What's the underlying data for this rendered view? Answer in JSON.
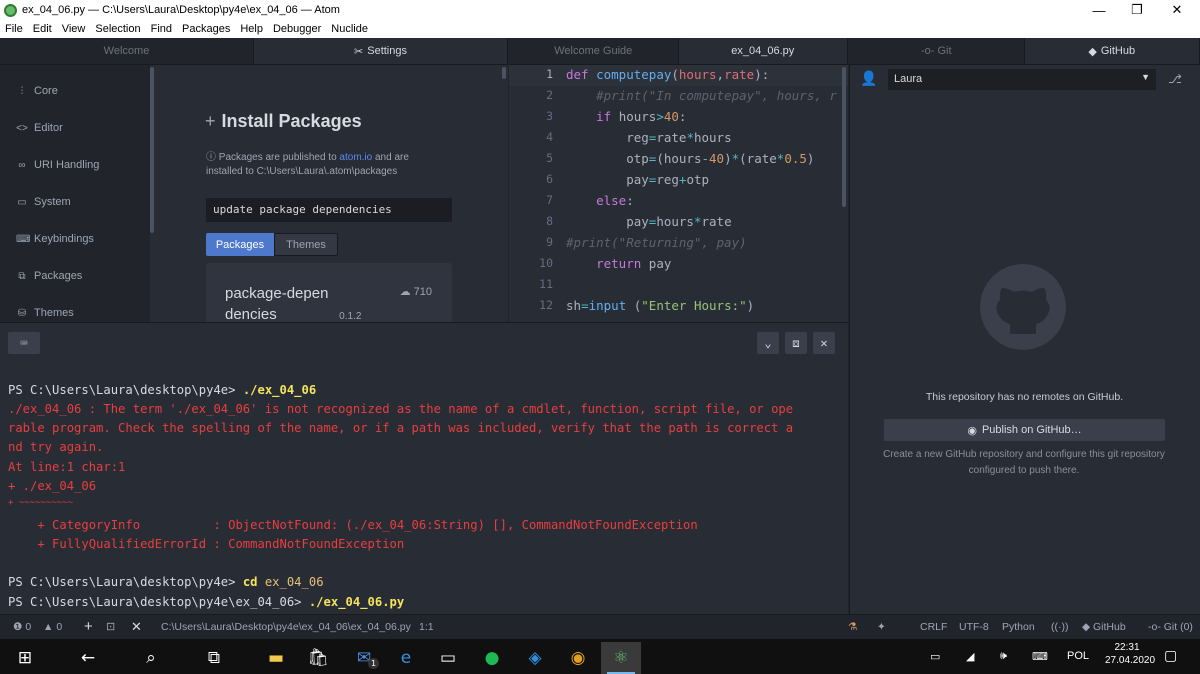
{
  "window": {
    "title": "ex_04_06.py — C:\\Users\\Laura\\Desktop\\py4e\\ex_04_06 — Atom"
  },
  "menu": [
    "File",
    "Edit",
    "View",
    "Selection",
    "Find",
    "Packages",
    "Help",
    "Debugger",
    "Nuclide"
  ],
  "tabs_left": [
    {
      "label": "Welcome"
    },
    {
      "label": "Settings",
      "icon": "tools-icon"
    }
  ],
  "tabs_mid": [
    {
      "label": "Welcome Guide"
    },
    {
      "label": "ex_04_06.py"
    }
  ],
  "tabs_right": [
    {
      "label": "Git",
      "icon": "git-commit-icon"
    },
    {
      "label": "GitHub",
      "icon": "github-icon"
    }
  ],
  "settings": {
    "nav": [
      "Core",
      "Editor",
      "URI Handling",
      "System",
      "Keybindings",
      "Packages",
      "Themes"
    ],
    "install_title": "Install Packages",
    "note_pre": "Packages are published to",
    "note_link": "atom.io",
    "note_post": "and are installed to C:\\Users\\Laura\\.atom\\packages",
    "search_value": "update package dependencies",
    "seg_packages": "Packages",
    "seg_themes": "Themes",
    "package": {
      "name": "package-dependencies",
      "version": "0.1.2",
      "downloads": "710"
    }
  },
  "editor": {
    "line_numbers": [
      "1",
      "2",
      "3",
      "4",
      "5",
      "6",
      "7",
      "8",
      "9",
      "10",
      "11",
      "12"
    ],
    "current_line": 1
  },
  "github": {
    "user": "Laura",
    "no_remotes": "This repository has no remotes on GitHub.",
    "publish_label": "Publish on GitHub…",
    "sub1": "Create a new GitHub repository and configure this git repository",
    "sub2": "configured to push there."
  },
  "terminal": {
    "prompt1": "PS C:\\Users\\Laura\\desktop\\py4e> ",
    "cmd1": "./ex_04_06",
    "err": [
      "./ex_04_06 : The term './ex_04_06' is not recognized as the name of a cmdlet, function, script file, or ope",
      "rable program. Check the spelling of the name, or if a path was included, verify that the path is correct a",
      "nd try again.",
      "At line:1 char:1",
      "+ ./ex_04_06",
      "+ ~~~~~~~~~~",
      "    + CategoryInfo          : ObjectNotFound: (./ex_04_06:String) [], CommandNotFoundException",
      "    + FullyQualifiedErrorId : CommandNotFoundException"
    ],
    "prompt2": "PS C:\\Users\\Laura\\desktop\\py4e> ",
    "cmd2a": "cd",
    "cmd2b": " ex_04_06",
    "prompt3": "PS C:\\Users\\Laura\\desktop\\py4e\\ex_04_06> ",
    "cmd3": "./ex_04_06.py"
  },
  "status": {
    "errors": "0",
    "warnings": "0",
    "path": "C:\\Users\\Laura\\Desktop\\py4e\\ex_04_06\\ex_04_06.py",
    "cursor": "1:1",
    "line_ending": "CRLF",
    "encoding": "UTF-8",
    "grammar": "Python",
    "github": "GitHub",
    "git": "Git (0)"
  },
  "taskbar": {
    "lang": "POL",
    "time": "22:31",
    "date": "27.04.2020",
    "mail_badge": "1"
  },
  "colors": {
    "accent": "#4d78cc",
    "error": "#e83e3e",
    "command": "#f4e45c"
  }
}
